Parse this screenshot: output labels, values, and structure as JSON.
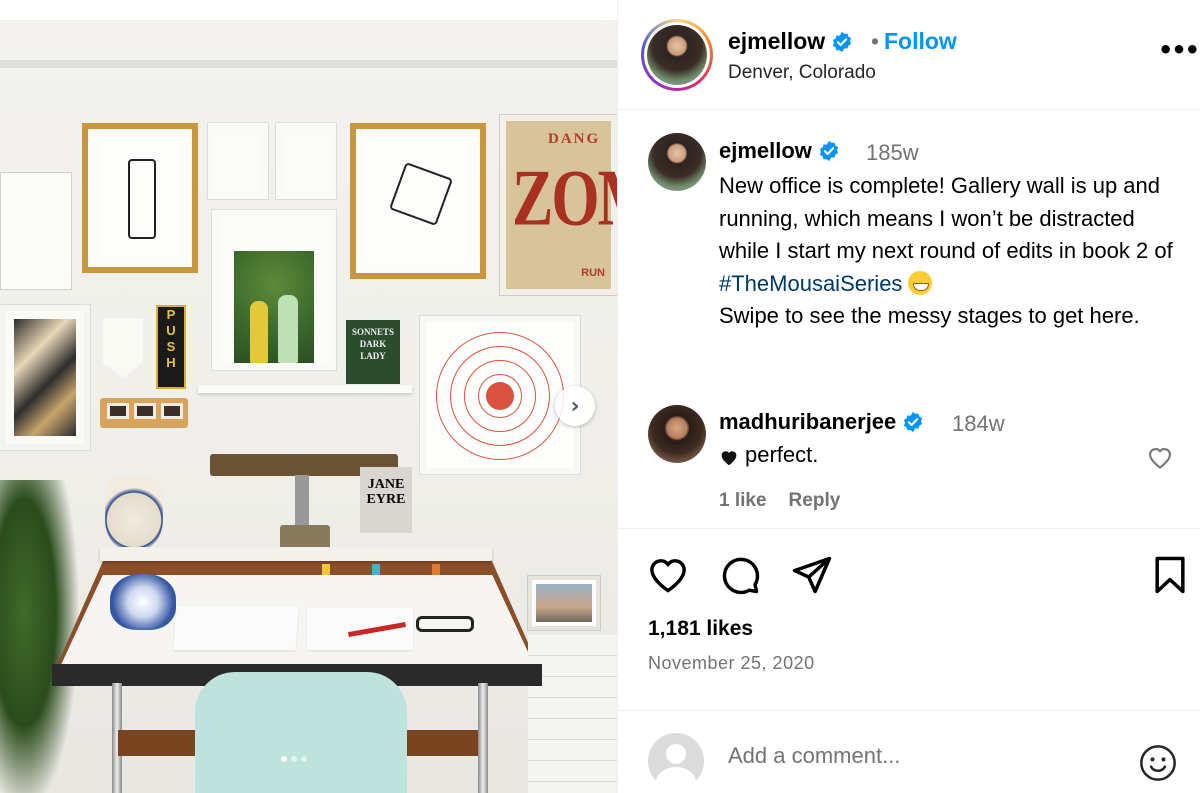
{
  "post": {
    "username": "ejmellow",
    "location": "Denver, Colorado",
    "follow_label": "Follow",
    "separator": "•",
    "more_label": "•••",
    "caption": {
      "username": "ejmellow",
      "time": "185w",
      "text_before": "New office is complete! Gallery wall is up and running, which means I won’t be distracted while I start my next round of edits in book 2 of ",
      "hashtag": "#TheMousaiSeries",
      "text_after": "Swipe to see the messy stages to get here.",
      "emoji": "grinning-face-emoji"
    },
    "comments": [
      {
        "username": "madhuribanerjee",
        "time": "184w",
        "text": "perfect.",
        "prefix_icon": "black-heart-icon",
        "likes_label": "1 like",
        "reply_label": "Reply"
      }
    ],
    "likes_label": "1,181 likes",
    "date": "November 25, 2020",
    "add_comment_placeholder": "Add a comment...",
    "carousel": {
      "current_index": 1,
      "total": 3,
      "next_icon": "chevron-right-icon"
    }
  },
  "photo_text": {
    "poster_top": "DANG",
    "poster_main": "ZOMI",
    "poster_bottom": "RUN",
    "push_sign": [
      "P",
      "U",
      "S",
      "H"
    ],
    "sonnets": "SONNETS DARK LADY",
    "jane_eyre": "JANE EYRE"
  },
  "colors": {
    "accent": "#0095f6",
    "hashtag": "#00376b",
    "secondary_text": "#737373",
    "verified": "#0095f6"
  }
}
